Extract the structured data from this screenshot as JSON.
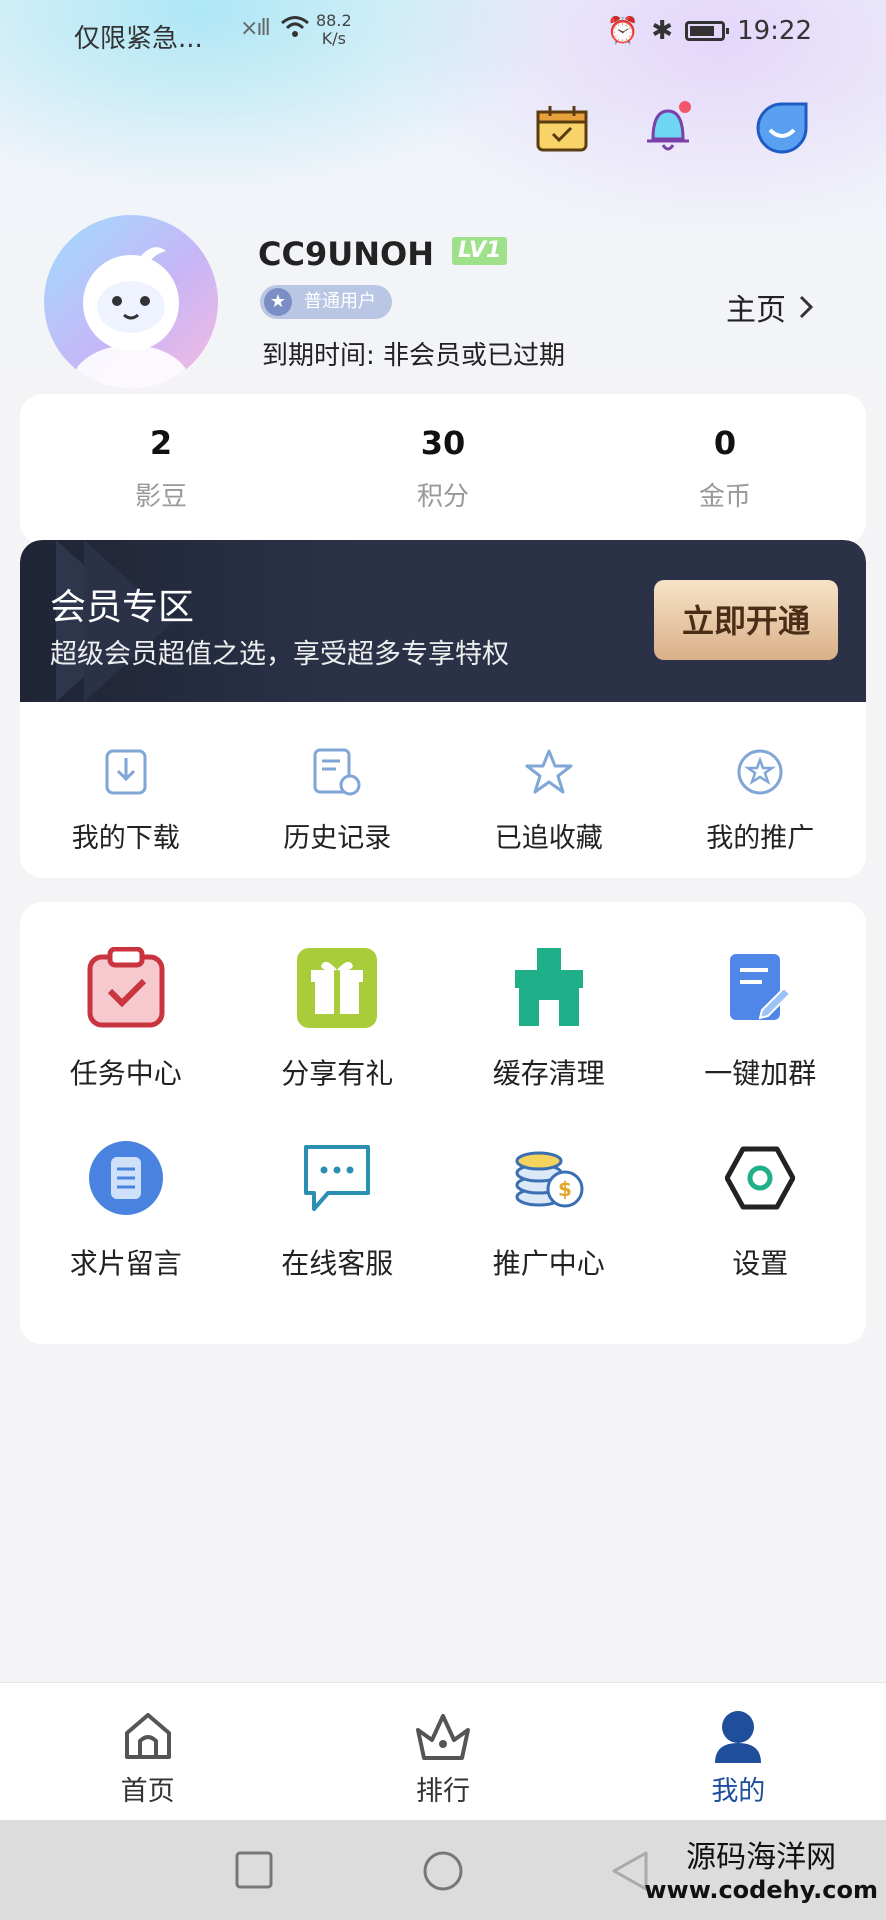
{
  "status_bar": {
    "carrier": "仅限紧急...",
    "speed": "88.2",
    "speed_unit": "K/s",
    "time": "19:22"
  },
  "profile": {
    "username": "CC9UNOH",
    "level": "LV1",
    "member_type": "普通用户",
    "expire_label": "到期时间:",
    "expire_value": "非会员或已过期",
    "home_link": "主页"
  },
  "stats": [
    {
      "value": "2",
      "label": "影豆"
    },
    {
      "value": "30",
      "label": "积分"
    },
    {
      "value": "0",
      "label": "金币"
    }
  ],
  "vip": {
    "title": "会员专区",
    "subtitle": "超级会员超值之选，享受超多专享特权",
    "button": "立即开通"
  },
  "quick_actions": [
    {
      "label": "我的下载",
      "icon": "download-icon"
    },
    {
      "label": "历史记录",
      "icon": "history-icon"
    },
    {
      "label": "已追收藏",
      "icon": "star-icon"
    },
    {
      "label": "我的推广",
      "icon": "promote-icon"
    }
  ],
  "tools": [
    {
      "label": "任务中心",
      "icon": "task-icon"
    },
    {
      "label": "分享有礼",
      "icon": "gift-icon"
    },
    {
      "label": "缓存清理",
      "icon": "broom-icon"
    },
    {
      "label": "一键加群",
      "icon": "group-note-icon"
    },
    {
      "label": "求片留言",
      "icon": "message-list-icon"
    },
    {
      "label": "在线客服",
      "icon": "chat-icon"
    },
    {
      "label": "推广中心",
      "icon": "coins-icon"
    },
    {
      "label": "设置",
      "icon": "settings-icon"
    }
  ],
  "tabs": [
    {
      "label": "首页",
      "icon": "home-icon"
    },
    {
      "label": "排行",
      "icon": "crown-icon"
    },
    {
      "label": "我的",
      "icon": "user-icon",
      "active": true
    }
  ],
  "watermark": {
    "name": "源码海洋网",
    "url": "www.codehy.com"
  },
  "colors": {
    "accent": "#1e4e9c",
    "vip_bg": "#2b3248",
    "vip_button": "#d9b088",
    "level_badge": "#9fe08a"
  }
}
